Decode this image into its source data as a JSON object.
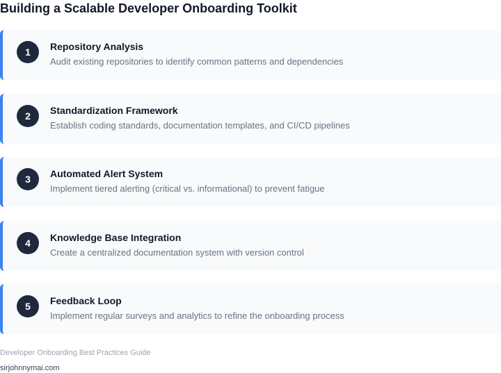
{
  "title": "Building a Scalable Developer Onboarding Toolkit",
  "steps": [
    {
      "number": "1",
      "title": "Repository Analysis",
      "description": "Audit existing repositories to identify common patterns and dependencies"
    },
    {
      "number": "2",
      "title": "Standardization Framework",
      "description": "Establish coding standards, documentation templates, and CI/CD pipelines"
    },
    {
      "number": "3",
      "title": "Automated Alert System",
      "description": "Implement tiered alerting (critical vs. informational) to prevent fatigue"
    },
    {
      "number": "4",
      "title": "Knowledge Base Integration",
      "description": "Create a centralized documentation system with version control"
    },
    {
      "number": "5",
      "title": "Feedback Loop",
      "description": "Implement regular surveys and analytics to refine the onboarding process"
    }
  ],
  "footer": {
    "guide": "Developer Onboarding Best Practices Guide",
    "site": "sirjohnnymai.com"
  },
  "colors": {
    "accent": "#3b82f6",
    "badge": "#1e293b",
    "card_bg": "#f8fafc"
  }
}
